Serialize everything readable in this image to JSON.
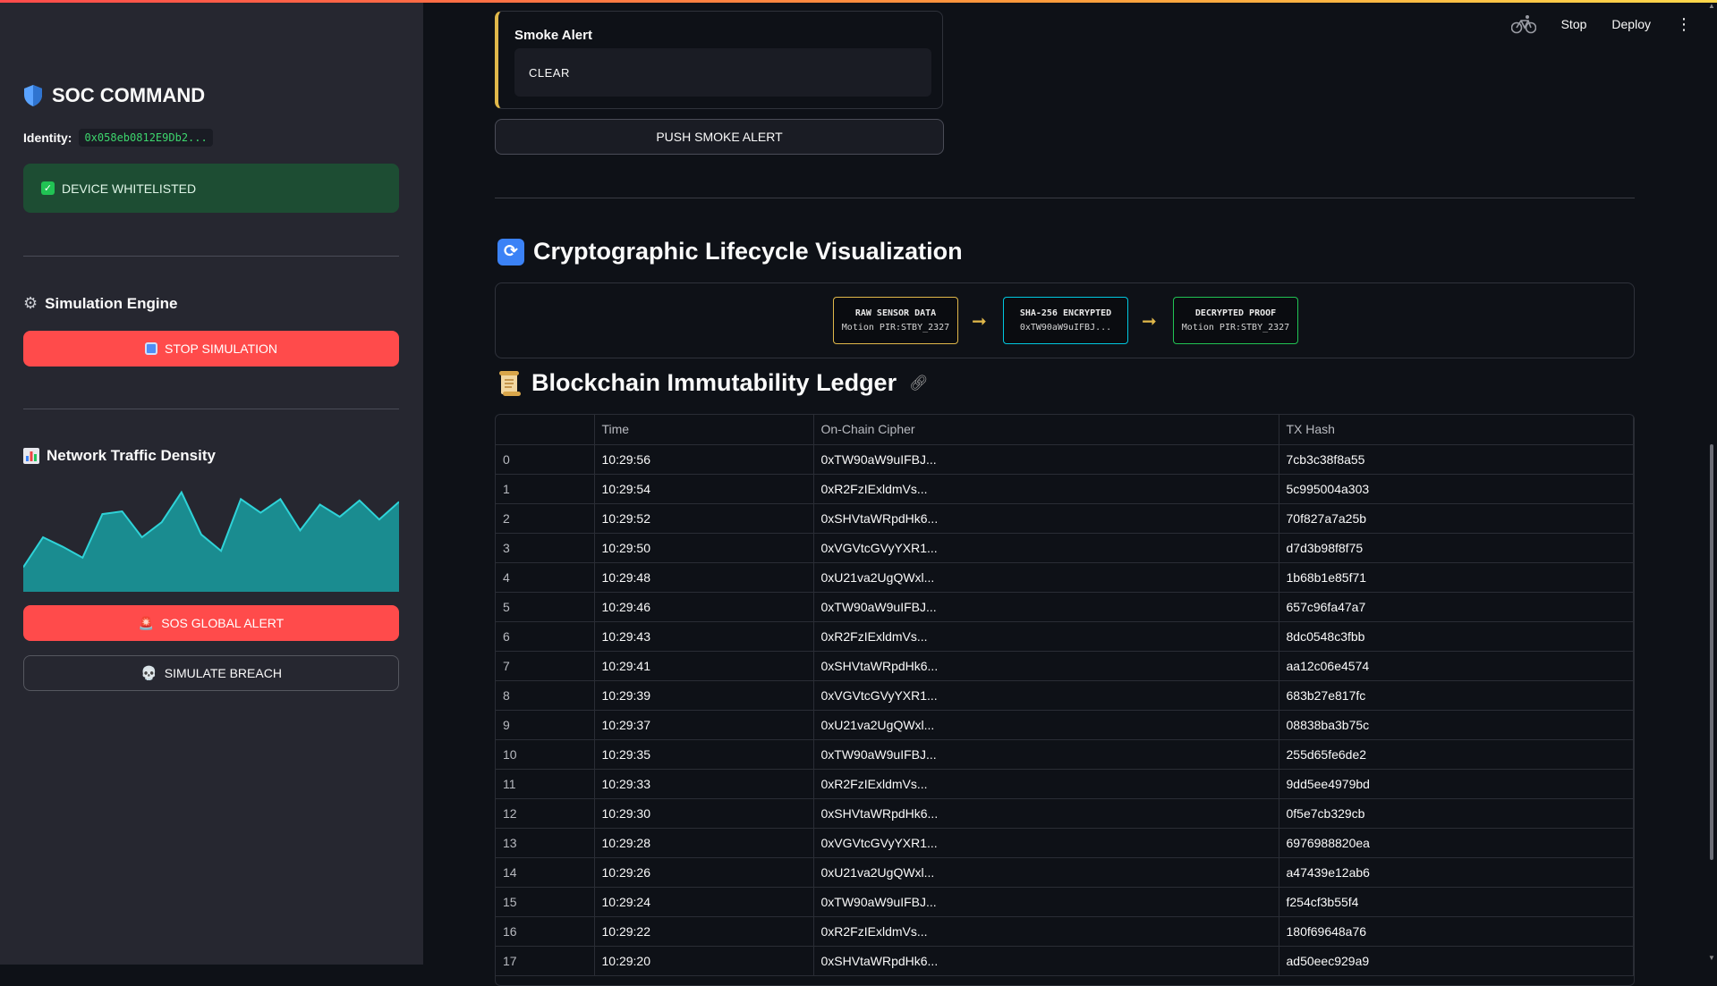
{
  "colors": {
    "accent_red": "#ff4b4b",
    "success_green": "#1d4d33",
    "warning_gold": "#e0b84a",
    "node_raw": "#e0b84a",
    "node_enc": "#00c8e0",
    "node_proof": "#21c354"
  },
  "sidebar": {
    "title": "SOC COMMAND",
    "identity_label": "Identity:",
    "identity_value": "0x058eb0812E9Db2...",
    "status": "DEVICE WHITELISTED",
    "sim_title": "Simulation Engine",
    "stop_button": "STOP SIMULATION",
    "traffic_title": "Network Traffic Density",
    "sos_button": "SOS GLOBAL ALERT",
    "breach_button": "SIMULATE BREACH"
  },
  "topbar": {
    "stop": "Stop",
    "deploy": "Deploy",
    "menu": "⋮"
  },
  "smoke": {
    "label": "Smoke Alert",
    "value": "CLEAR",
    "push_button": "PUSH SMOKE ALERT"
  },
  "lifecycle": {
    "title": "Cryptographic Lifecycle Visualization",
    "nodes": [
      {
        "title": "RAW SENSOR DATA",
        "value": "Motion PIR:STBY_2327"
      },
      {
        "title": "SHA-256 ENCRYPTED",
        "value": "0xTW90aW9uIFBJ..."
      },
      {
        "title": "DECRYPTED PROOF",
        "value": "Motion PIR:STBY_2327"
      }
    ]
  },
  "ledger": {
    "title": "Blockchain Immutability Ledger",
    "columns": [
      "",
      "Time",
      "On-Chain Cipher",
      "TX Hash"
    ],
    "rows": [
      [
        "0",
        "10:29:56",
        "0xTW90aW9uIFBJ...",
        "7cb3c38f8a55"
      ],
      [
        "1",
        "10:29:54",
        "0xR2FzIExldmVs...",
        "5c995004a303"
      ],
      [
        "2",
        "10:29:52",
        "0xSHVtaWRpdHk6...",
        "70f827a7a25b"
      ],
      [
        "3",
        "10:29:50",
        "0xVGVtcGVyYXR1...",
        "d7d3b98f8f75"
      ],
      [
        "4",
        "10:29:48",
        "0xU21va2UgQWxl...",
        "1b68b1e85f71"
      ],
      [
        "5",
        "10:29:46",
        "0xTW90aW9uIFBJ...",
        "657c96fa47a7"
      ],
      [
        "6",
        "10:29:43",
        "0xR2FzIExldmVs...",
        "8dc0548c3fbb"
      ],
      [
        "7",
        "10:29:41",
        "0xSHVtaWRpdHk6...",
        "aa12c06e4574"
      ],
      [
        "8",
        "10:29:39",
        "0xVGVtcGVyYXR1...",
        "683b27e817fc"
      ],
      [
        "9",
        "10:29:37",
        "0xU21va2UgQWxl...",
        "08838ba3b75c"
      ],
      [
        "10",
        "10:29:35",
        "0xTW90aW9uIFBJ...",
        "255d65fe6de2"
      ],
      [
        "11",
        "10:29:33",
        "0xR2FzIExldmVs...",
        "9dd5ee4979bd"
      ],
      [
        "12",
        "10:29:30",
        "0xSHVtaWRpdHk6...",
        "0f5e7cb329cb"
      ],
      [
        "13",
        "10:29:28",
        "0xVGVtcGVyYXR1...",
        "6976988820ea"
      ],
      [
        "14",
        "10:29:26",
        "0xU21va2UgQWxl...",
        "a47439e12ab6"
      ],
      [
        "15",
        "10:29:24",
        "0xTW90aW9uIFBJ...",
        "f254cf3b55f4"
      ],
      [
        "16",
        "10:29:22",
        "0xR2FzIExldmVs...",
        "180f69648a76"
      ],
      [
        "17",
        "10:29:20",
        "0xSHVtaWRpdHk6...",
        "ad50eec929a9"
      ]
    ]
  },
  "chart_data": {
    "type": "area",
    "title": "Network Traffic Density",
    "values": [
      18,
      40,
      33,
      25,
      57,
      59,
      40,
      51,
      73,
      42,
      30,
      68,
      58,
      68,
      45,
      64,
      55,
      67,
      53,
      66
    ]
  }
}
